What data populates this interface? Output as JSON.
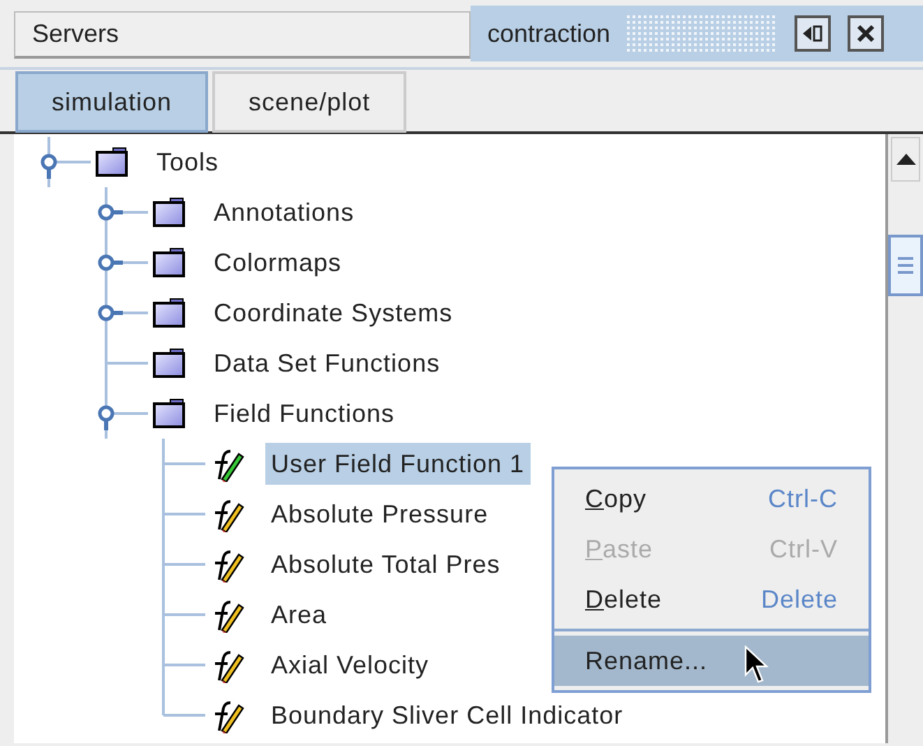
{
  "header": {
    "servers_title": "Servers",
    "panel_title": "contraction"
  },
  "tabs": [
    {
      "label": "simulation",
      "selected": true
    },
    {
      "label": "scene/plot",
      "selected": false
    }
  ],
  "tree": [
    {
      "label": "Tools",
      "kind": "folder",
      "expanded": true,
      "children": [
        {
          "label": "Annotations",
          "kind": "folder",
          "expanded": false
        },
        {
          "label": "Colormaps",
          "kind": "folder",
          "expanded": false
        },
        {
          "label": "Coordinate Systems",
          "kind": "folder",
          "expanded": false
        },
        {
          "label": "Data Set Functions",
          "kind": "folder"
        },
        {
          "label": "Field Functions",
          "kind": "folder",
          "expanded": true,
          "children": [
            {
              "label": "User Field Function 1",
              "kind": "user_function",
              "selected": true
            },
            {
              "label": "Absolute Pressure",
              "kind": "function",
              "selected": false
            },
            {
              "label": "Absolute Total Pres",
              "kind": "function",
              "selected": false
            },
            {
              "label": "Area",
              "kind": "function",
              "selected": false
            },
            {
              "label": "Axial Velocity",
              "kind": "function",
              "selected": false
            },
            {
              "label": "Boundary Sliver Cell Indicator",
              "kind": "function",
              "selected": false
            }
          ]
        }
      ]
    }
  ],
  "context_menu": [
    {
      "label": "Copy",
      "shortcut": "Ctrl-C",
      "mnemonic": true,
      "disabled": false,
      "selected": false
    },
    {
      "label": "Paste",
      "shortcut": "Ctrl-V",
      "mnemonic": true,
      "disabled": true,
      "selected": false
    },
    {
      "label": "Delete",
      "shortcut": "Delete",
      "mnemonic": true,
      "disabled": false,
      "selected": false
    },
    {
      "label": "Rename...",
      "mnemonic": false,
      "disabled": false,
      "selected": true,
      "separator_before": true
    }
  ]
}
